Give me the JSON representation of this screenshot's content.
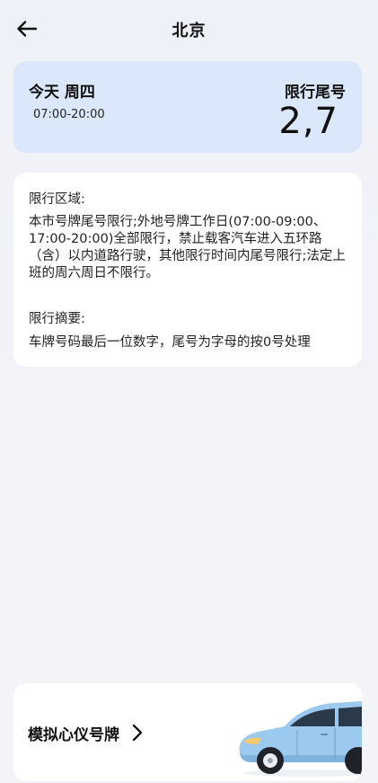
{
  "header": {
    "title": "北京"
  },
  "today": {
    "date_label": "今天 周四",
    "time_range": "07:00-20:00",
    "limit_label": "限行尾号",
    "limit_numbers": "2,7"
  },
  "info": {
    "area_title": "限行区域:",
    "area_body": "本市号牌尾号限行;外地号牌工作日(07:00-09:00、17:00-20:00)全部限行，禁止载客汽车进入五环路（含）以内道路行驶，其他限行时间内尾号限行;法定上班的周六周日不限行。",
    "summary_title": "限行摘要:",
    "summary_body": "车牌号码最后一位数字，尾号为字母的按0号处理"
  },
  "bottom": {
    "simulate_label": "模拟心仪号牌"
  },
  "colors": {
    "card_blue": "#dbe8fb",
    "car_body": "#9cc9ee",
    "background": "#f1f3f8"
  },
  "icons": {
    "back": "back-arrow-icon",
    "chevron": "chevron-right-icon",
    "car": "car-illustration"
  }
}
